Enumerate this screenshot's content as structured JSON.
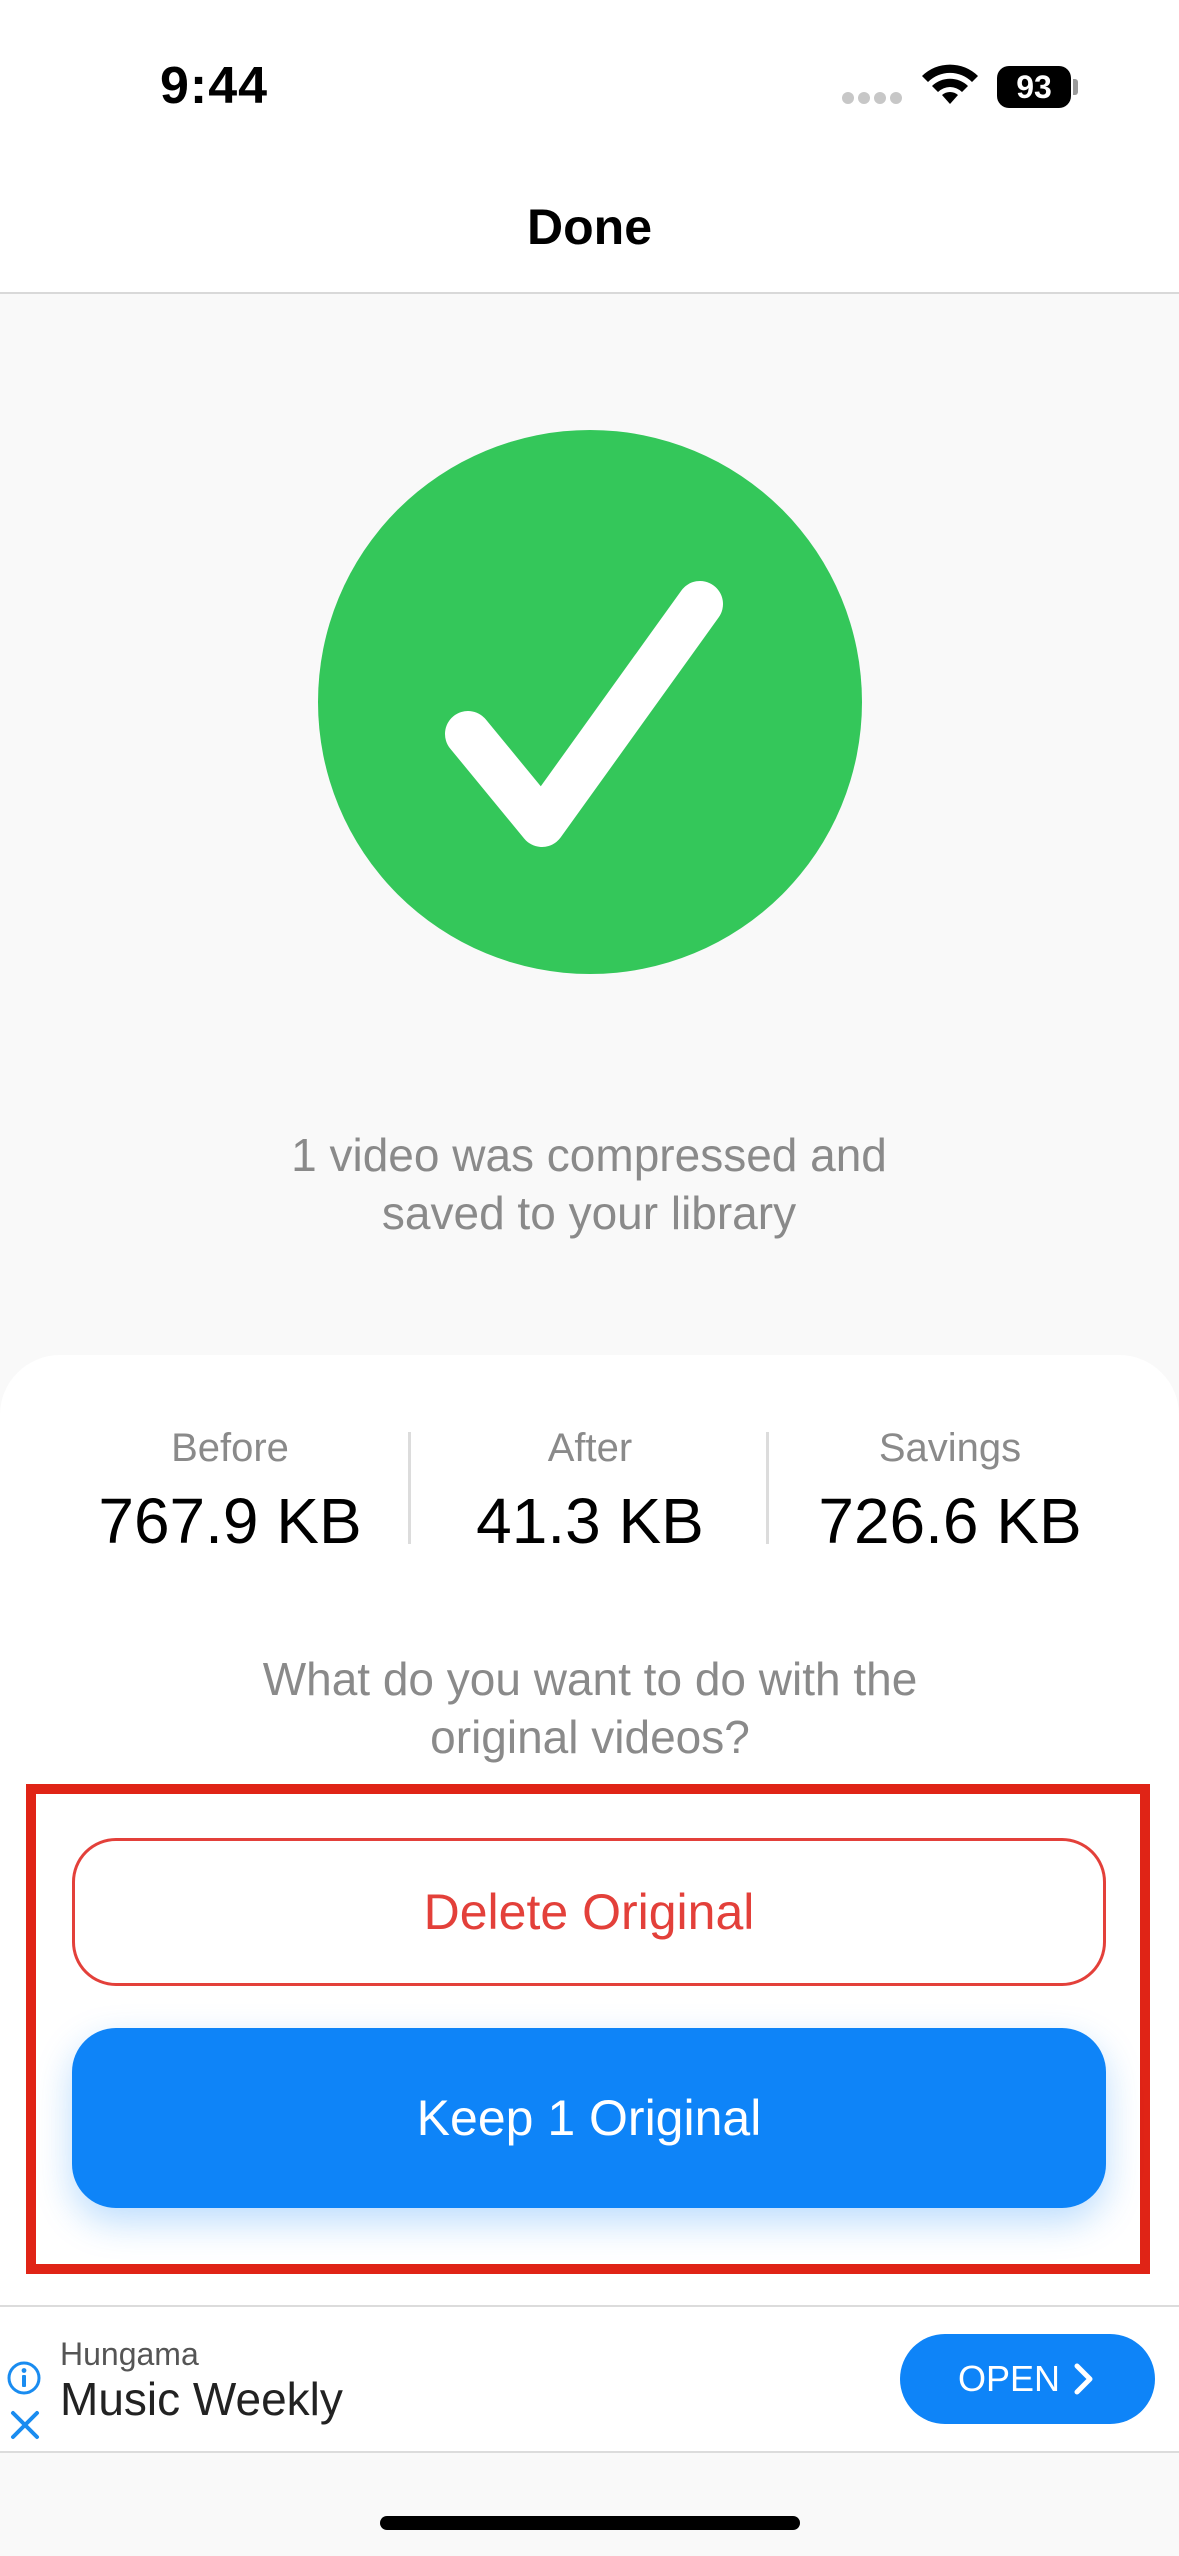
{
  "status_bar": {
    "time": "9:44",
    "battery": "93"
  },
  "nav": {
    "title": "Done"
  },
  "success": {
    "icon": "checkmark-icon",
    "color": "#34c75a",
    "message_line1": "1 video was compressed and",
    "message_line2": "saved to your library"
  },
  "stats": [
    {
      "label": "Before",
      "value": "767.9 KB"
    },
    {
      "label": "After",
      "value": "41.3 KB"
    },
    {
      "label": "Savings",
      "value": "726.6 KB"
    }
  ],
  "question": {
    "line1": "What do you want to do with the",
    "line2": "original videos?"
  },
  "actions": {
    "delete_label": "Delete Original",
    "keep_label": "Keep 1 Original",
    "delete_color": "#e3403a",
    "keep_color": "#0e84f8",
    "highlight_color": "#e02416"
  },
  "ad": {
    "advertiser": "Hungama",
    "title": "Music Weekly",
    "cta": "OPEN",
    "info_icon": "info-icon",
    "close_icon": "close-icon"
  }
}
